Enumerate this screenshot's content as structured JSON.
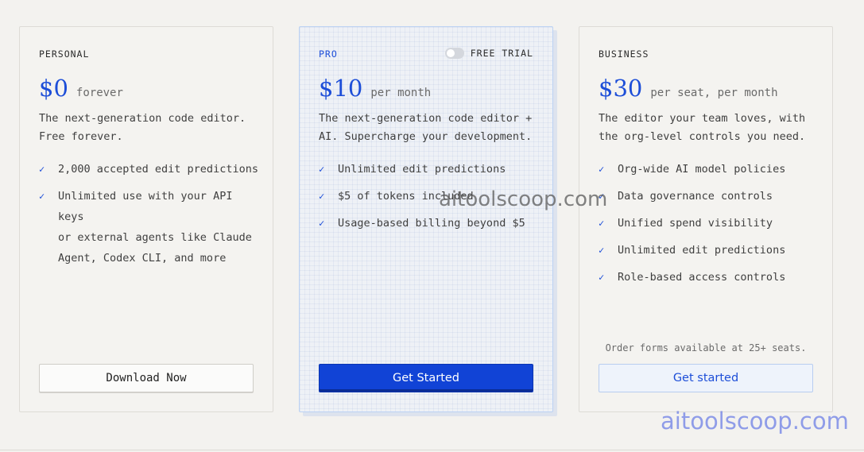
{
  "plans": {
    "personal": {
      "label": "PERSONAL",
      "price": "$0",
      "unit": "forever",
      "desc": [
        "The next-generation code editor.",
        "Free forever."
      ],
      "features": [
        [
          "2,000 accepted edit predictions"
        ],
        [
          "Unlimited use with your API keys",
          "or external agents like Claude",
          "Agent, Codex CLI, and more"
        ]
      ],
      "button": "Download Now"
    },
    "pro": {
      "label": "PRO",
      "trial_label": "FREE TRIAL",
      "price": "$10",
      "unit": "per month",
      "desc": [
        "The next-generation code editor +",
        "AI. Supercharge your development."
      ],
      "features": [
        [
          "Unlimited edit predictions"
        ],
        [
          "$5 of tokens included"
        ],
        [
          "Usage-based billing beyond $5"
        ]
      ],
      "button": "Get Started"
    },
    "business": {
      "label": "BUSINESS",
      "price": "$30",
      "unit": "per seat, per month",
      "desc": [
        "The editor your team loves, with",
        "the org-level controls you need."
      ],
      "features": [
        [
          "Org-wide AI model policies"
        ],
        [
          "Data governance controls"
        ],
        [
          "Unified spend visibility"
        ],
        [
          "Unlimited edit predictions"
        ],
        [
          "Role-based access controls"
        ]
      ],
      "note": "Order forms available at 25+ seats.",
      "button": "Get started"
    }
  },
  "icons": {
    "check": "check-icon"
  },
  "colors": {
    "accent": "#1d4ed8",
    "primary_button": "#1143d6"
  },
  "watermarks": [
    "aitoolscoop.com",
    "aitoolscoop.com"
  ]
}
